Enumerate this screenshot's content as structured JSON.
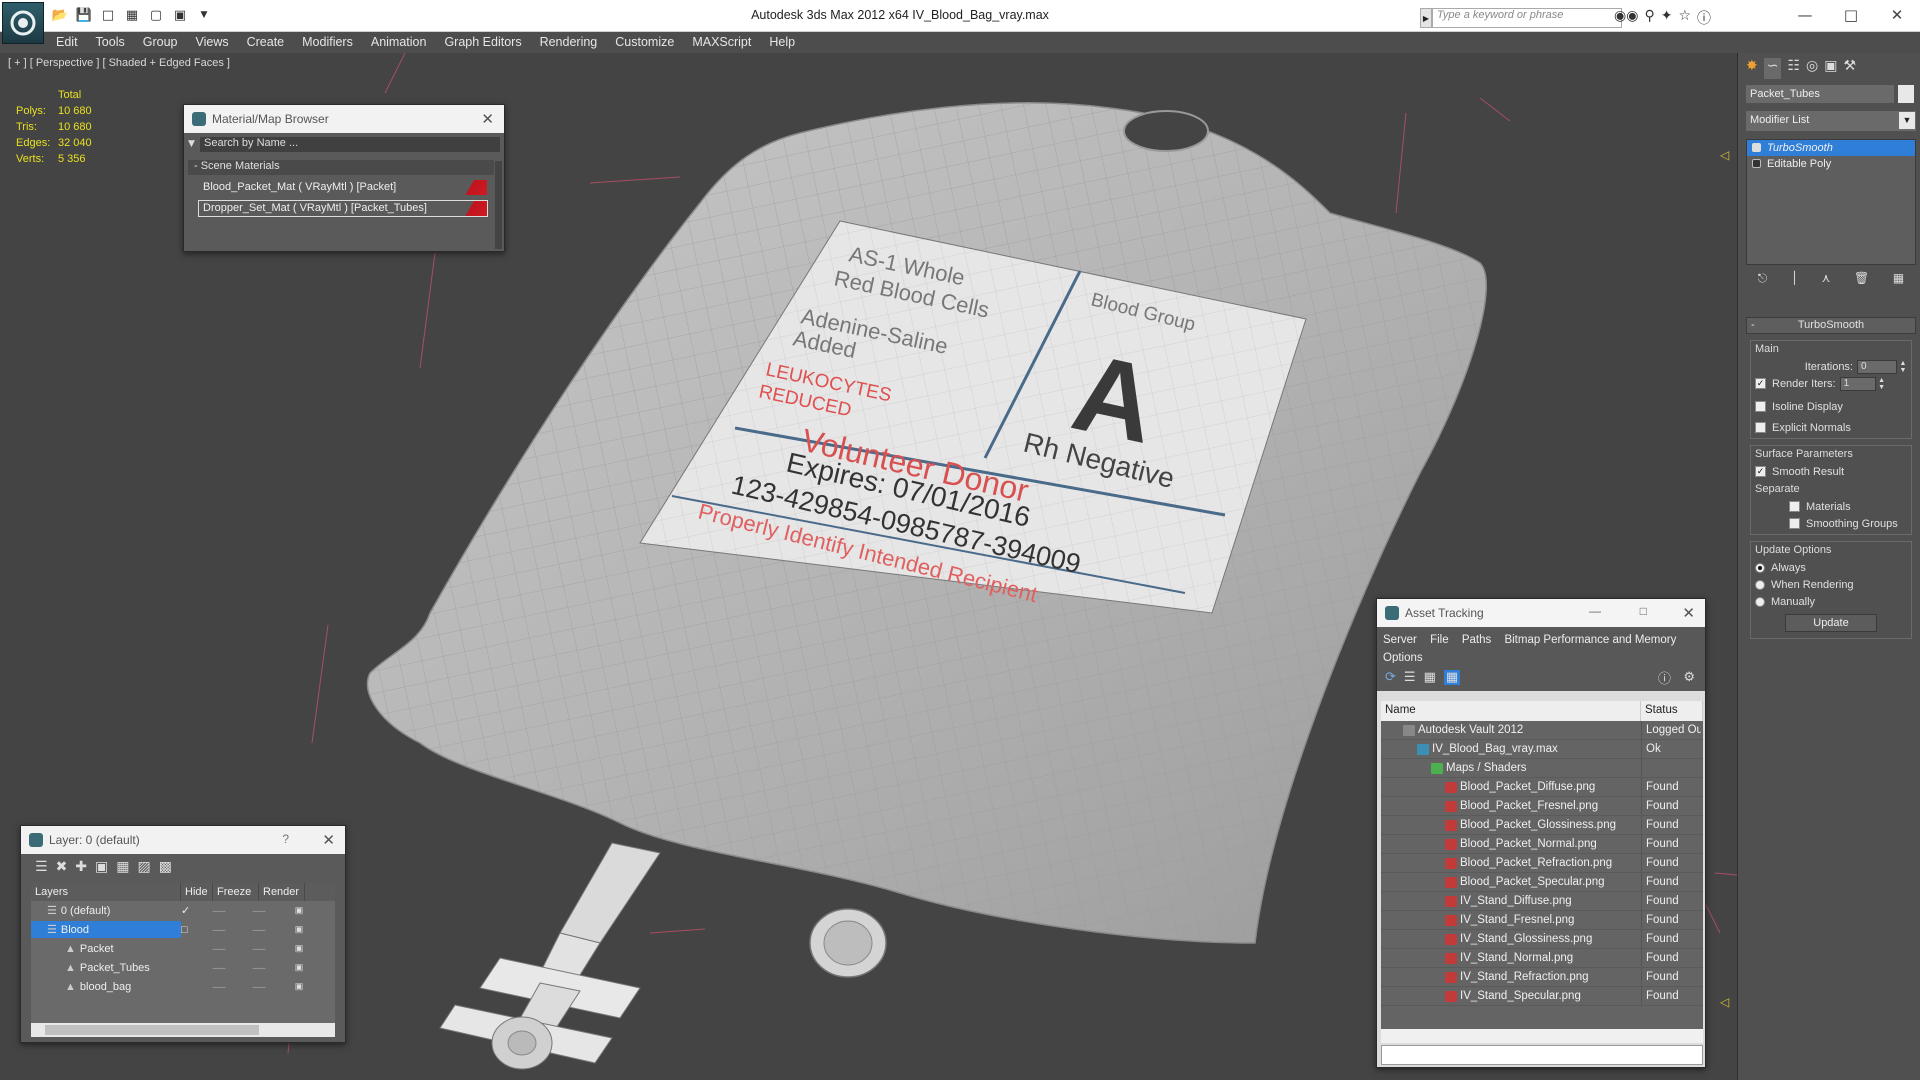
{
  "window": {
    "title": "Autodesk 3ds Max  2012 x64     IV_Blood_Bag_vray.max",
    "search_placeholder": "Type a keyword or phrase"
  },
  "menu": [
    "Edit",
    "Tools",
    "Group",
    "Views",
    "Create",
    "Modifiers",
    "Animation",
    "Graph Editors",
    "Rendering",
    "Customize",
    "MAXScript",
    "Help"
  ],
  "viewport": {
    "label": "[ + ] [ Perspective ] [ Shaded + Edged Faces ]",
    "stats": {
      "header": "Total",
      "rows": [
        {
          "label": "Polys:",
          "value": "10 680"
        },
        {
          "label": "Tris:",
          "value": "10 680"
        },
        {
          "label": "Edges:",
          "value": "32 040"
        },
        {
          "label": "Verts:",
          "value": "5 356"
        }
      ]
    },
    "label_sticker": {
      "line1": "AS-1 Whole",
      "line2": "Red Blood Cells",
      "line3": "Adenine-Saline",
      "line4": "Added",
      "line5": "LEUKOCYTES",
      "line6": "REDUCED",
      "group_title": "Blood Group",
      "group_letter": "A",
      "rh": "Rh Negative",
      "donor": "Volunteer Donor",
      "expires": "Expires: 07/01/2016",
      "code": "123-429854-0985787-394009",
      "warning": "Properly Identify Intended Recipient"
    }
  },
  "material_browser": {
    "title": "Material/Map Browser",
    "search_placeholder": "Search by Name ...",
    "section": "- Scene Materials",
    "materials": [
      "Blood_Packet_Mat  ( VRayMtl ) [Packet]",
      "Dropper_Set_Mat  ( VRayMtl ) [Packet_Tubes]"
    ]
  },
  "layer_window": {
    "title": "Layer: 0 (default)",
    "help": "?",
    "columns": [
      "Layers",
      "Hide",
      "Freeze",
      "Render"
    ],
    "rows": [
      {
        "name": "0 (default)",
        "indent": 1,
        "selected": false
      },
      {
        "name": "Blood",
        "indent": 1,
        "selected": true
      },
      {
        "name": "Packet",
        "indent": 2,
        "selected": false
      },
      {
        "name": "Packet_Tubes",
        "indent": 2,
        "selected": false
      },
      {
        "name": "blood_bag",
        "indent": 2,
        "selected": false
      }
    ]
  },
  "asset_tracking": {
    "title": "Asset Tracking",
    "menu": [
      "Server",
      "File",
      "Paths",
      "Bitmap Performance and Memory",
      "Options"
    ],
    "columns": [
      "Name",
      "Status"
    ],
    "rows": [
      {
        "name": "Autodesk Vault 2012",
        "status": "Logged Ou",
        "level": 1,
        "icon": "vault"
      },
      {
        "name": "IV_Blood_Bag_vray.max",
        "status": "Ok",
        "level": 2,
        "icon": "max"
      },
      {
        "name": "Maps / Shaders",
        "status": "",
        "level": 3,
        "icon": "maps"
      },
      {
        "name": "Blood_Packet_Diffuse.png",
        "status": "Found",
        "level": 4,
        "icon": "png"
      },
      {
        "name": "Blood_Packet_Fresnel.png",
        "status": "Found",
        "level": 4,
        "icon": "png"
      },
      {
        "name": "Blood_Packet_Glossiness.png",
        "status": "Found",
        "level": 4,
        "icon": "png"
      },
      {
        "name": "Blood_Packet_Normal.png",
        "status": "Found",
        "level": 4,
        "icon": "png"
      },
      {
        "name": "Blood_Packet_Refraction.png",
        "status": "Found",
        "level": 4,
        "icon": "png"
      },
      {
        "name": "Blood_Packet_Specular.png",
        "status": "Found",
        "level": 4,
        "icon": "png"
      },
      {
        "name": "IV_Stand_Diffuse.png",
        "status": "Found",
        "level": 4,
        "icon": "png"
      },
      {
        "name": "IV_Stand_Fresnel.png",
        "status": "Found",
        "level": 4,
        "icon": "png"
      },
      {
        "name": "IV_Stand_Glossiness.png",
        "status": "Found",
        "level": 4,
        "icon": "png"
      },
      {
        "name": "IV_Stand_Normal.png",
        "status": "Found",
        "level": 4,
        "icon": "png"
      },
      {
        "name": "IV_Stand_Refraction.png",
        "status": "Found",
        "level": 4,
        "icon": "png"
      },
      {
        "name": "IV_Stand_Specular.png",
        "status": "Found",
        "level": 4,
        "icon": "png"
      }
    ]
  },
  "command_panel": {
    "object_name": "Packet_Tubes",
    "modifier_list": "Modifier List",
    "stack": [
      {
        "name": "TurboSmooth",
        "selected": true
      },
      {
        "name": "Editable Poly",
        "selected": false
      }
    ],
    "rollout_title": "TurboSmooth",
    "main_group": "Main",
    "iterations_label": "Iterations:",
    "iterations_value": "0",
    "render_iters_label": "Render Iters:",
    "render_iters_value": "1",
    "isoline_label": "Isoline Display",
    "explicit_label": "Explicit Normals",
    "surface_group": "Surface Parameters",
    "smooth_result_label": "Smooth Result",
    "separate_label": "Separate",
    "materials_label": "Materials",
    "smoothing_groups_label": "Smoothing Groups",
    "update_group": "Update Options",
    "always_label": "Always",
    "when_rendering_label": "When Rendering",
    "manually_label": "Manually",
    "update_button": "Update"
  },
  "colors": {
    "selection": "#2f7fd8",
    "stats_yellow": "#e8e020",
    "material_red": "#c0141e"
  }
}
